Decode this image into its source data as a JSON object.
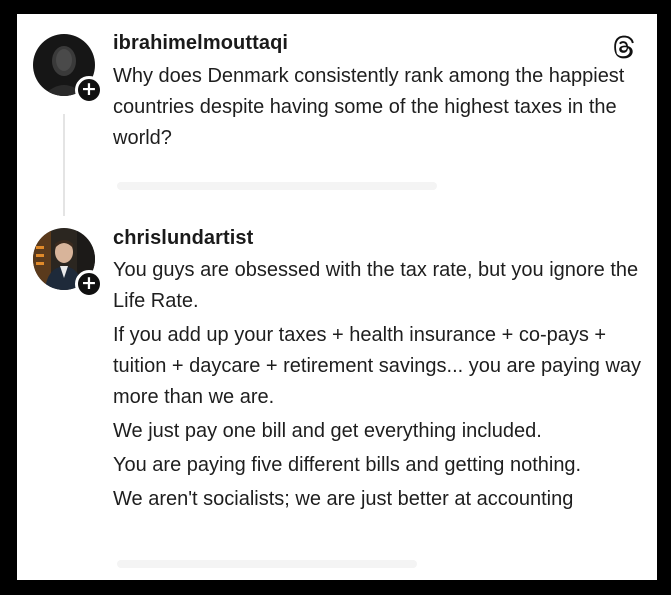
{
  "posts": [
    {
      "username": "ibrahimelmouttaqi",
      "paragraphs": [
        "Why does Denmark consistently rank among the happiest countries despite having some of the highest taxes in the world?"
      ]
    },
    {
      "username": "chrislundartist",
      "paragraphs": [
        "You guys are obsessed with the tax rate, but you ignore the Life Rate.",
        "If you add up your taxes + health insurance + co-pays + tuition + daycare + retirement savings... you are paying way more than we are.",
        "We just pay one bill and get everything included.",
        "You are paying five different bills and getting nothing.",
        "We aren't socialists; we are just better at accounting"
      ]
    }
  ],
  "icons": {
    "app_logo": "threads-icon",
    "follow": "plus-icon",
    "follow_glyph": "+"
  }
}
